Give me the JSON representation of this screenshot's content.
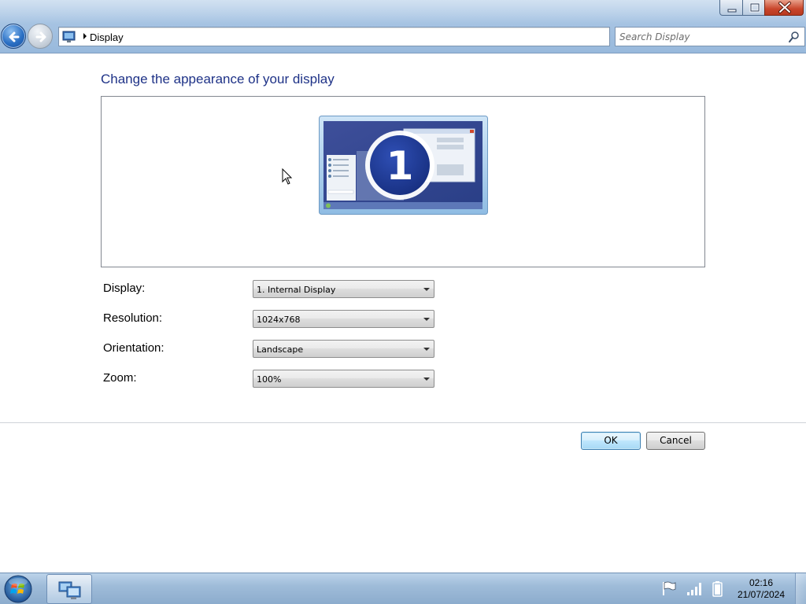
{
  "window": {
    "breadcrumb": "Display",
    "search_placeholder": "Search Display",
    "icons": {
      "back": "back-arrow-icon",
      "forward": "forward-arrow-icon",
      "control_panel": "control-panel-icon",
      "search": "search-icon",
      "minimize": "minimize-icon",
      "maximize": "maximize-icon",
      "close": "close-icon"
    }
  },
  "main": {
    "heading": "Change the appearance of your display",
    "monitor_number": "1",
    "settings": [
      {
        "label": "Display:",
        "value": "1. Internal Display"
      },
      {
        "label": "Resolution:",
        "value": "1024x768"
      },
      {
        "label": "Orientation:",
        "value": "Landscape"
      },
      {
        "label": "Zoom:",
        "value": "100%"
      }
    ],
    "buttons": {
      "ok": "OK",
      "cancel": "Cancel"
    }
  },
  "taskbar": {
    "pinned": [
      "display-control-panel-icon"
    ],
    "tray": [
      "action-center-flag-icon",
      "network-signal-icon",
      "battery-icon"
    ],
    "time": "02:16",
    "date": "21/07/2024"
  },
  "colors": {
    "heading": "#1e3287",
    "accent": "#2a6fc4"
  }
}
